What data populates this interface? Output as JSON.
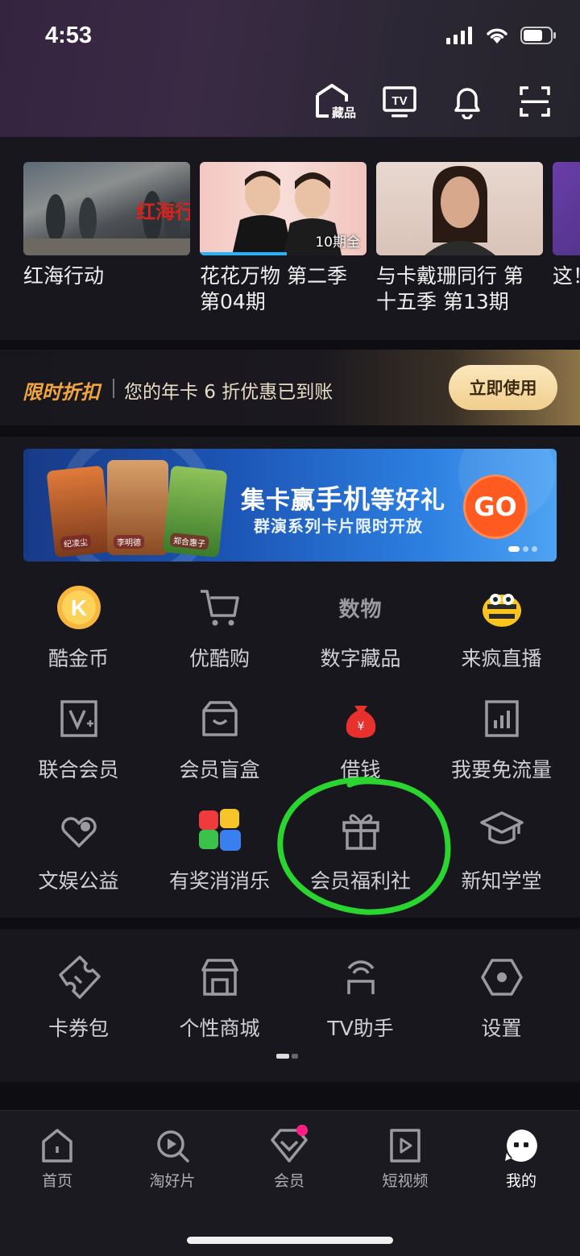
{
  "status_bar": {
    "time": "4:53"
  },
  "header": {
    "collection_icon_label": "藏品",
    "icons": [
      "collection-icon",
      "tv-icon",
      "bell-icon",
      "scan-icon"
    ]
  },
  "history": {
    "items": [
      {
        "title": "红海行动",
        "thumb_caption": "红海行动"
      },
      {
        "title": "花花万物 第二季 第04期",
        "badge": "10期全"
      },
      {
        "title": "与卡戴珊同行 第十五季 第13期"
      },
      {
        "title": "这！二季"
      }
    ]
  },
  "promo": {
    "tag": "限时折扣",
    "text": "您的年卡 6 折优惠已到账",
    "button": "立即使用"
  },
  "banner": {
    "headline_pre": "集卡赢",
    "headline_hl": "手机",
    "headline_post": "等好礼",
    "subline": "群演系列卡片限时开放",
    "go": "GO",
    "card_names": [
      "纪凌尘",
      "李明德",
      "郑合惠子"
    ]
  },
  "grid": {
    "row1": [
      {
        "label": "酷金币",
        "icon": "k-coin-icon"
      },
      {
        "label": "优酷购",
        "icon": "cart-icon"
      },
      {
        "label": "数字藏品",
        "icon": "digital-collection-icon",
        "icon_text": "数物"
      },
      {
        "label": "来疯直播",
        "icon": "bee-icon"
      }
    ],
    "row2": [
      {
        "label": "联合会员",
        "icon": "joint-vip-icon"
      },
      {
        "label": "会员盲盒",
        "icon": "blind-box-icon"
      },
      {
        "label": "借钱",
        "icon": "money-bag-icon"
      },
      {
        "label": "我要免流量",
        "icon": "data-plan-icon"
      }
    ],
    "row3": [
      {
        "label": "文娱公益",
        "icon": "charity-heart-icon"
      },
      {
        "label": "有奖消消乐",
        "icon": "match-game-icon"
      },
      {
        "label": "会员福利社",
        "icon": "gift-icon"
      },
      {
        "label": "新知学堂",
        "icon": "graduation-cap-icon"
      }
    ]
  },
  "tools": [
    {
      "label": "卡券包",
      "icon": "ticket-icon"
    },
    {
      "label": "个性商城",
      "icon": "store-icon"
    },
    {
      "label": "TV助手",
      "icon": "tv-assistant-icon"
    },
    {
      "label": "设置",
      "icon": "settings-icon"
    }
  ],
  "tabbar": [
    {
      "label": "首页",
      "icon": "home-icon"
    },
    {
      "label": "淘好片",
      "icon": "discover-icon"
    },
    {
      "label": "会员",
      "icon": "vip-diamond-icon"
    },
    {
      "label": "短视频",
      "icon": "short-video-icon"
    },
    {
      "label": "我的",
      "icon": "me-icon",
      "active": true
    }
  ],
  "colors": {
    "accent_gold": "#f2a640",
    "tab_badge": "#ff1f84",
    "annotation_green": "#2bd52f",
    "progress_blue": "#24b3ff"
  }
}
